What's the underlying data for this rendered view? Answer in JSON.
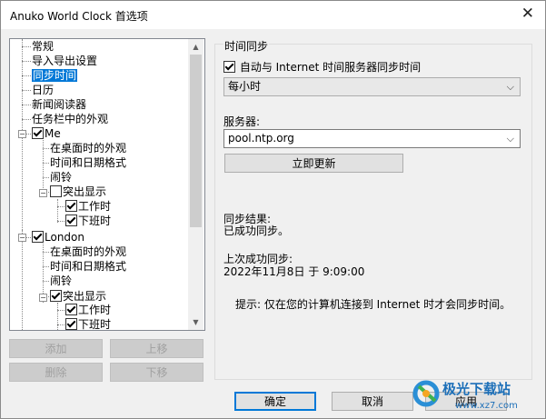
{
  "window": {
    "title": "Anuko World Clock 首选项",
    "close_glyph": "✕"
  },
  "tree": {
    "items": [
      {
        "label": "常规",
        "selected": false
      },
      {
        "label": "导入导出设置",
        "selected": false
      },
      {
        "label": "同步时间",
        "selected": true
      },
      {
        "label": "日历",
        "selected": false
      },
      {
        "label": "新闻阅读器",
        "selected": false
      },
      {
        "label": "任务栏中的外观",
        "selected": false
      },
      {
        "label": "Me",
        "checked": true
      },
      {
        "label": "在桌面时的外观"
      },
      {
        "label": "时间和日期格式"
      },
      {
        "label": "闹铃"
      },
      {
        "label": "突出显示",
        "checked": false
      },
      {
        "label": "工作时",
        "checked": true
      },
      {
        "label": "下班时",
        "checked": true
      },
      {
        "label": "London",
        "checked": true
      },
      {
        "label": "在桌面时的外观"
      },
      {
        "label": "时间和日期格式"
      },
      {
        "label": "闹铃"
      },
      {
        "label": "突出显示",
        "checked": true
      },
      {
        "label": "工作时",
        "checked": true
      },
      {
        "label": "下班时",
        "checked": true
      }
    ],
    "expand_minus": "−",
    "scroll_up": "▲",
    "scroll_down": "▼"
  },
  "left_buttons": {
    "add": "添加",
    "move_up": "上移",
    "delete": "删除",
    "move_down": "下移"
  },
  "sync": {
    "group_title": "时间同步",
    "auto_sync_label": "自动与 Internet 时间服务器同步时间",
    "auto_sync_checked": true,
    "frequency_value": "每小时",
    "server_label": "服务器:",
    "server_value": "pool.ntp.org",
    "sync_now_button": "立即更新",
    "result_label": "同步结果:",
    "result_value": "已成功同步。",
    "last_sync_label": "上次成功同步:",
    "last_sync_value": "2022年11月8日 于 9:09:00",
    "hint": "提示: 仅在您的计算机连接到 Internet 时才会同步时间。"
  },
  "bottom_buttons": {
    "ok": "确定",
    "cancel": "取消",
    "apply": "应用"
  },
  "watermark": {
    "text": "极光下载站",
    "url": "www.xz7.com"
  },
  "colors": {
    "selection": "#0078d7",
    "accent": "#0078d7"
  }
}
